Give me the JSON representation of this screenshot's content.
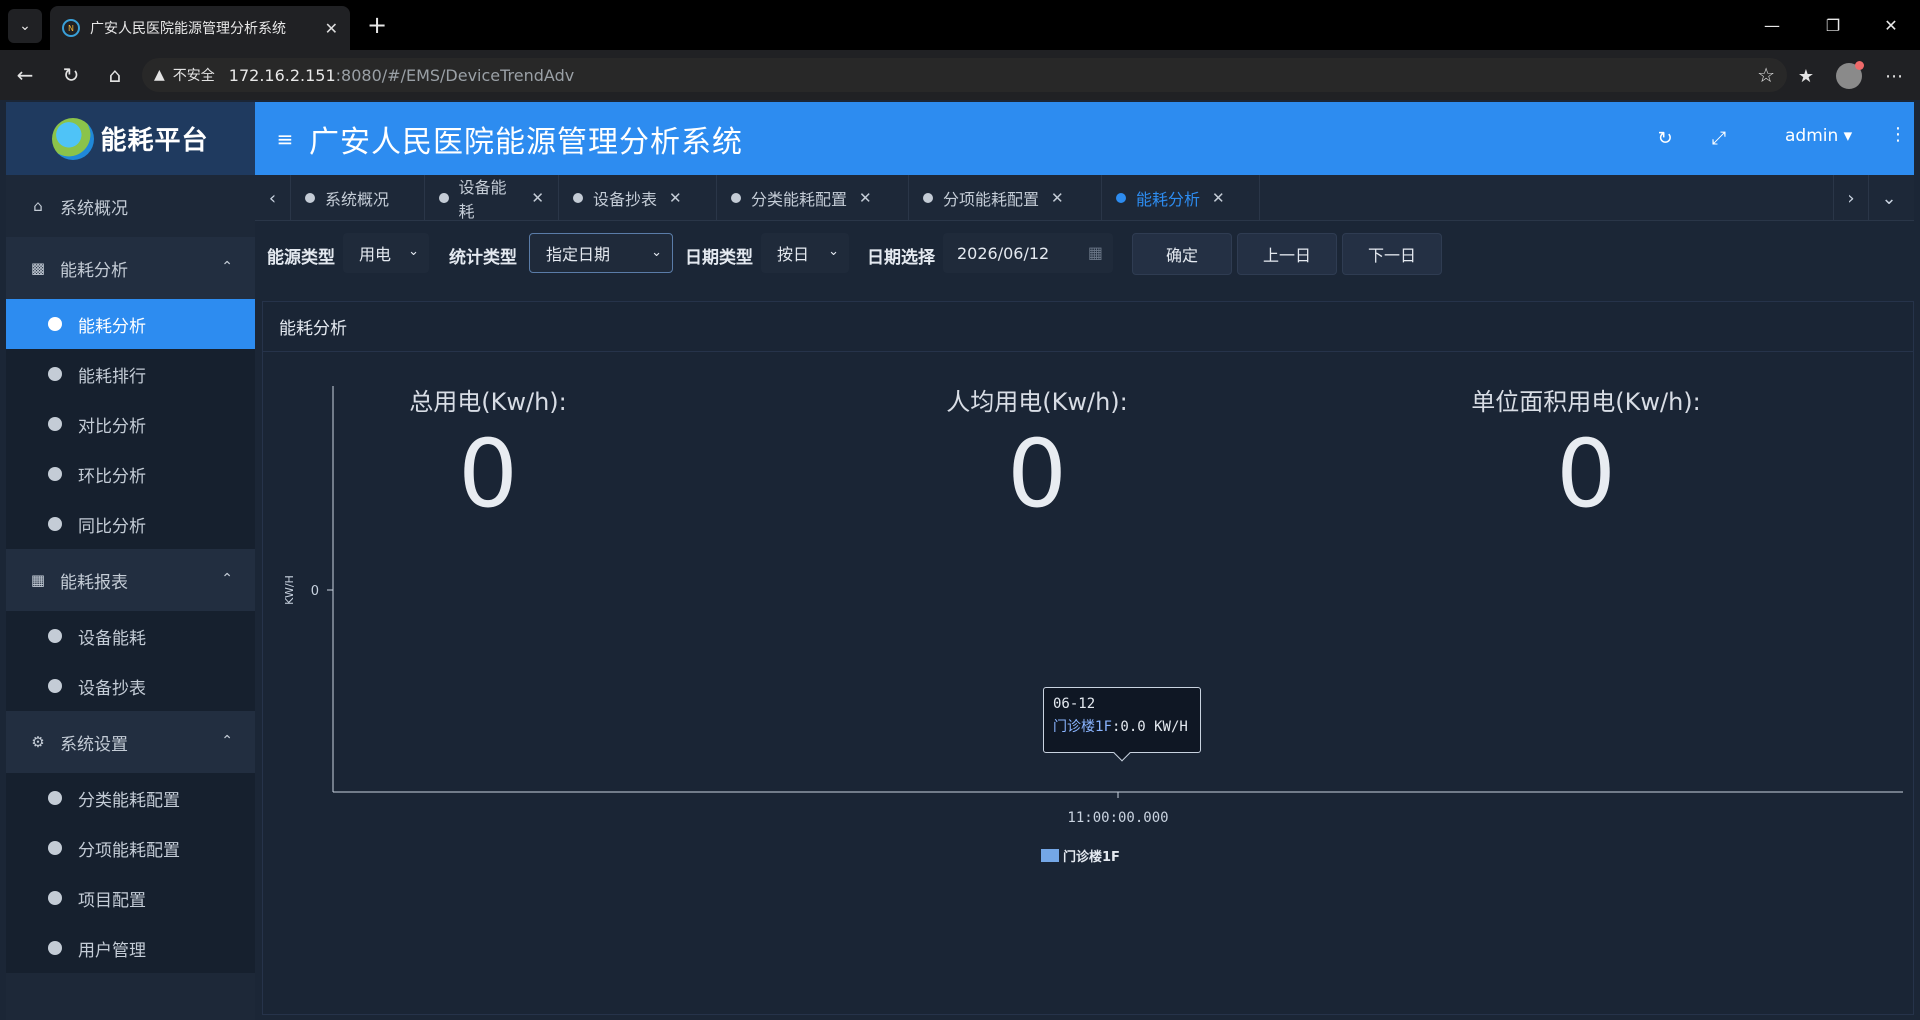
{
  "browser": {
    "tab_title": "广安人民医院能源管理分析系统",
    "insecure_label": "不安全",
    "url_host": "172.16.2.151",
    "url_rest": ":8080/#/EMS/DeviceTrendAdv"
  },
  "header": {
    "logo_text": "能耗平台",
    "title": "广安人民医院能源管理分析系统",
    "user": "admin"
  },
  "sidebar": {
    "home": "系统概况",
    "groups": [
      {
        "label": "能耗分析",
        "items": [
          "能耗分析",
          "能耗排行",
          "对比分析",
          "环比分析",
          "同比分析"
        ]
      },
      {
        "label": "能耗报表",
        "items": [
          "设备能耗",
          "设备抄表"
        ]
      },
      {
        "label": "系统设置",
        "items": [
          "分类能耗配置",
          "分项能耗配置",
          "项目配置",
          "用户管理"
        ]
      }
    ],
    "active_item": "能耗分析"
  },
  "tabs": [
    "系统概况",
    "设备能耗",
    "设备抄表",
    "分类能耗配置",
    "分项能耗配置",
    "能耗分析"
  ],
  "active_tab": "能耗分析",
  "filters": {
    "energy_type_label": "能源类型",
    "energy_type_value": "用电",
    "stat_type_label": "统计类型",
    "stat_type_value": "指定日期",
    "date_type_label": "日期类型",
    "date_type_value": "按日",
    "date_select_label": "日期选择",
    "date_value": "2026/06/12",
    "confirm": "确定",
    "prev_day": "上一日",
    "next_day": "下一日"
  },
  "panel": {
    "title": "能耗分析",
    "stats": [
      {
        "label": "总用电(Kw/h):",
        "value": "0"
      },
      {
        "label": "人均用电(Kw/h):",
        "value": "0"
      },
      {
        "label": "单位面积用电(Kw/h):",
        "value": "0"
      }
    ]
  },
  "tooltip": {
    "date": "06-12",
    "series": "门诊楼1F",
    "value": ":0.0 KW/H"
  },
  "chart_data": {
    "type": "bar",
    "categories": [
      "11:00:00.000"
    ],
    "series": [
      {
        "name": "门诊楼1F",
        "values": [
          0
        ]
      }
    ],
    "ylabel": "KW/H",
    "y_ticks": [
      "0"
    ],
    "legend_position": "bottom",
    "colors": {
      "series": "#74a7e6",
      "axis": "#c9d3e0"
    }
  }
}
